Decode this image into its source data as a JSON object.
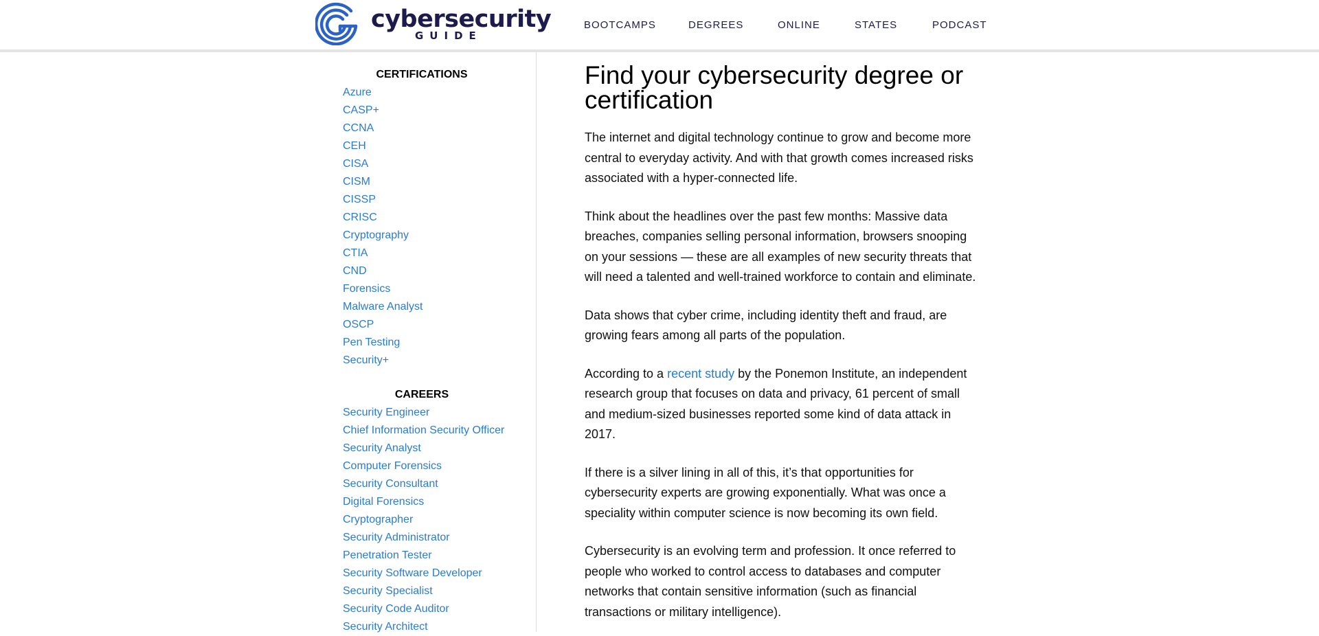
{
  "brand": {
    "name": "cybersecurity",
    "tagline": "GUIDE",
    "colors": {
      "navy": "#1d1b4b",
      "logo_blue": "#2b62c6",
      "link_blue": "#2b7bd0"
    },
    "logo_icon": "spiral-g-logo-icon"
  },
  "nav": {
    "items": [
      {
        "label": "BOOTCAMPS"
      },
      {
        "label": "DEGREES"
      },
      {
        "label": "ONLINE"
      },
      {
        "label": "STATES"
      },
      {
        "label": "PODCAST"
      }
    ]
  },
  "sidebar": {
    "certifications": {
      "heading": "CERTIFICATIONS",
      "items": [
        {
          "label": "Azure"
        },
        {
          "label": "CASP+"
        },
        {
          "label": "CCNA"
        },
        {
          "label": "CEH"
        },
        {
          "label": "CISA"
        },
        {
          "label": "CISM"
        },
        {
          "label": "CISSP"
        },
        {
          "label": "CRISC"
        },
        {
          "label": "Cryptography"
        },
        {
          "label": "CTIA"
        },
        {
          "label": "CND"
        },
        {
          "label": "Forensics"
        },
        {
          "label": "Malware Analyst"
        },
        {
          "label": "OSCP"
        },
        {
          "label": "Pen Testing"
        },
        {
          "label": "Security+"
        }
      ]
    },
    "careers": {
      "heading": "CAREERS",
      "items": [
        {
          "label": "Security Engineer"
        },
        {
          "label": "Chief Information Security Officer"
        },
        {
          "label": "Security Analyst"
        },
        {
          "label": "Computer Forensics"
        },
        {
          "label": "Security Consultant"
        },
        {
          "label": "Digital Forensics"
        },
        {
          "label": "Cryptographer"
        },
        {
          "label": "Security Administrator"
        },
        {
          "label": "Penetration Tester"
        },
        {
          "label": "Security Software Developer"
        },
        {
          "label": "Security Specialist"
        },
        {
          "label": "Security Code Auditor"
        },
        {
          "label": "Security Architect"
        }
      ]
    }
  },
  "main": {
    "title": "Find your cybersecurity degree or certification",
    "paragraphs": {
      "p1": "The internet and digital technology continue to grow and become more central to everyday activity. And with that growth comes increased risks associated with a hyper-connected life.",
      "p2": "Think about the headlines over the past few months: Massive data breaches, companies selling personal information, browsers snooping on your sessions — these are all examples of new security threats that will need a talented and well-trained workforce to contain and eliminate.",
      "p3": "Data shows that cyber crime, including identity theft and fraud, are growing fears among all parts of the population.",
      "p4_before": "According to a ",
      "p4_link": "recent study",
      "p4_after": " by the Ponemon Institute, an independent research group that focuses on data and privacy, 61 percent of small and medium-sized businesses reported some kind of data attack in 2017.",
      "p5": "If there is a silver lining in all of this, it’s that opportunities for cybersecurity experts are growing exponentially. What was once a speciality within computer science is now becoming its own field.",
      "p6": "Cybersecurity is an evolving term and profession. It once referred to people who worked to control access to databases and computer networks that contain sensitive information (such as financial transactions or military intelligence)."
    }
  }
}
